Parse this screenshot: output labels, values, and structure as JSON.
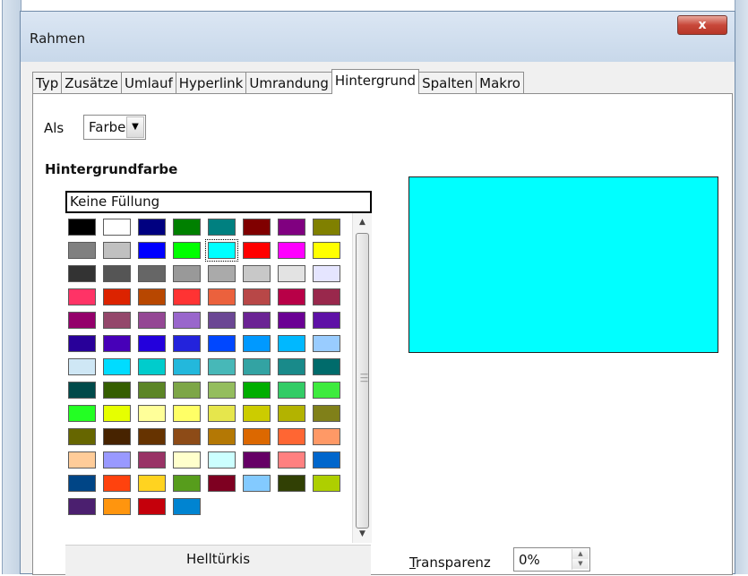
{
  "window": {
    "title": "Rahmen",
    "close_glyph": "x"
  },
  "tabs": [
    {
      "label": "Typ",
      "active": false
    },
    {
      "label": "Zusätze",
      "active": false
    },
    {
      "label": "Umlauf",
      "active": false
    },
    {
      "label": "Hyperlink",
      "active": false
    },
    {
      "label": "Umrandung",
      "active": false
    },
    {
      "label": "Hintergrund",
      "active": true
    },
    {
      "label": "Spalten",
      "active": false
    },
    {
      "label": "Makro",
      "active": false
    }
  ],
  "als": {
    "label": "Als",
    "value": "Farbe"
  },
  "background": {
    "section_title": "Hintergrundfarbe",
    "none_option": "Keine Füllung",
    "selected_color_name": "Helltürkis",
    "selected_color": "#00ffff",
    "palette_rows": [
      [
        "#000000",
        "#ffffff",
        "#000080",
        "#008000",
        "#008080",
        "#800000",
        "#800080",
        "#808000"
      ],
      [
        "#808080",
        "#c0c0c0",
        "#0000ff",
        "#00ff00",
        "#00ffff",
        "#ff0000",
        "#ff00ff",
        "#ffff00"
      ],
      [
        "#333333",
        "#555555",
        "#666666",
        "#999999",
        "#aaaaaa",
        "#c8c8c8",
        "#e3e3e3",
        "#e5e5ff"
      ],
      [
        "#ff3366",
        "#dc2300",
        "#b84700",
        "#ff3333",
        "#eb613d",
        "#b84747",
        "#b80047",
        "#99284c"
      ],
      [
        "#94006b",
        "#94476b",
        "#944794",
        "#9966cc",
        "#6b4794",
        "#6b2394",
        "#6b0094",
        "#5e11a6"
      ],
      [
        "#280099",
        "#4700b8",
        "#2300dc",
        "#2323dc",
        "#0047ff",
        "#0099ff",
        "#00b8ff",
        "#99ccff"
      ],
      [
        "#cfe7f5",
        "#00dcff",
        "#00cccc",
        "#23b8dc",
        "#47b8b8",
        "#33a3a3",
        "#198a8a",
        "#006b6b"
      ],
      [
        "#004a4a",
        "#355e00",
        "#5c8526",
        "#7da647",
        "#94bd5e",
        "#00ae00",
        "#33cc66",
        "#3deb3d"
      ],
      [
        "#23ff23",
        "#e6ff00",
        "#ffff99",
        "#ffff66",
        "#e6e64c",
        "#cccc00",
        "#b3b300",
        "#808019"
      ],
      [
        "#666600",
        "#472300",
        "#663300",
        "#8d4b17",
        "#b47804",
        "#dc6800",
        "#ff6633",
        "#ff9966"
      ],
      [
        "#ffcc99",
        "#9999ff",
        "#993366",
        "#ffffcc",
        "#ccffff",
        "#660066",
        "#ff8080",
        "#0066cc"
      ],
      [
        "#004586",
        "#ff420e",
        "#ffd320",
        "#579d1c",
        "#7e0021",
        "#83caff",
        "#314004",
        "#aecf00"
      ],
      [
        "#4b1f6f",
        "#ff950e",
        "#c5000b",
        "#0084d1"
      ]
    ]
  },
  "transparency": {
    "label_first": "T",
    "label_rest": "ransparenz",
    "value": "0%"
  }
}
